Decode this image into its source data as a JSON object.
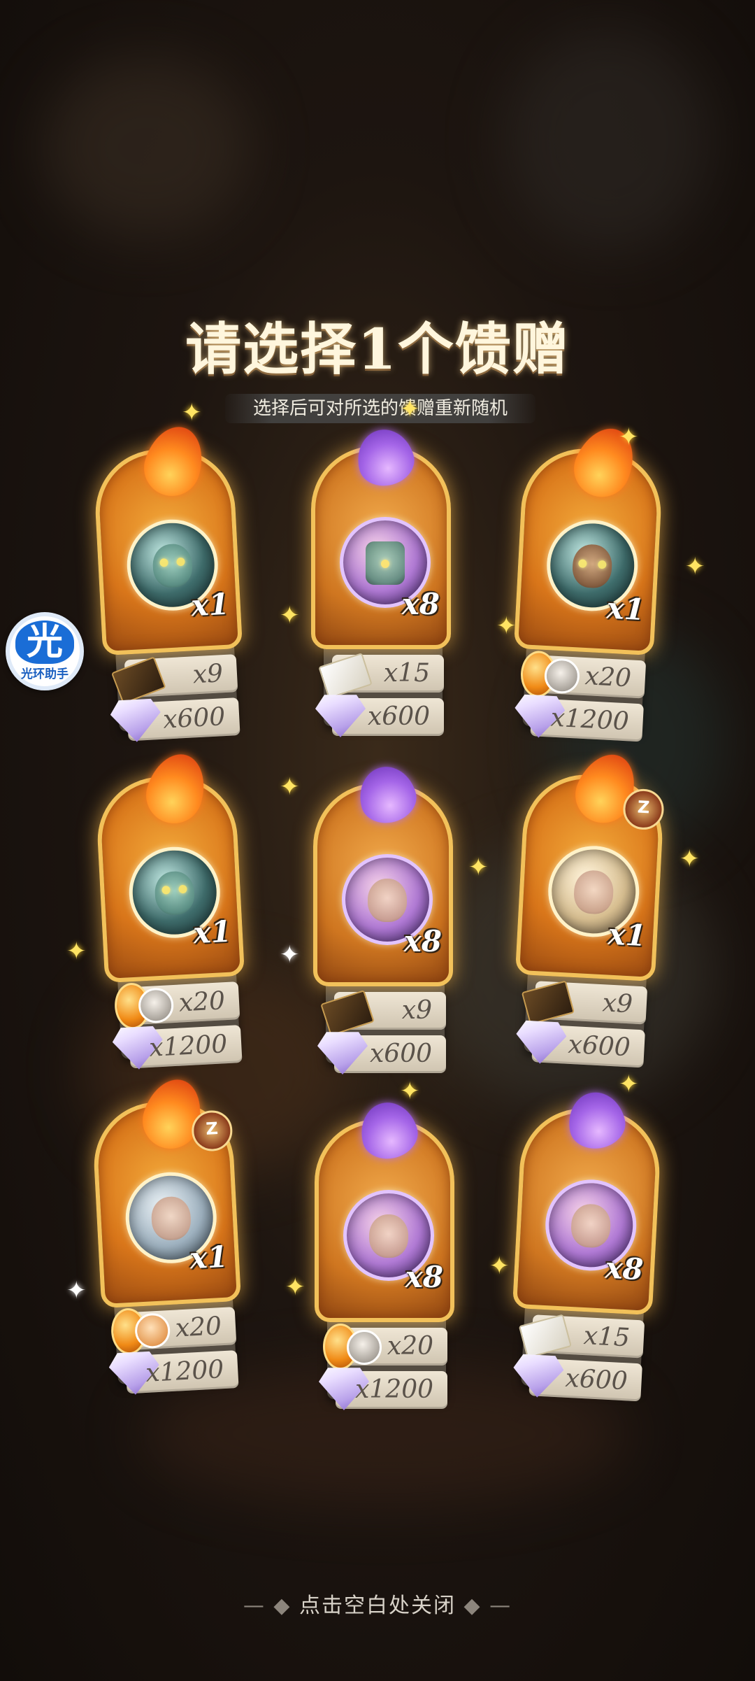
{
  "title": "请选择1个馈赠",
  "subtitle": "选择后可对所选的馈赠重新随机",
  "close_hint": "点击空白处关闭",
  "floating_button": {
    "icon_char": "光",
    "label": "光环助手"
  },
  "cards": [
    {
      "style": "fire",
      "multiplier": "x1",
      "item1_icon": "ticket-icon",
      "item1_value": "x9",
      "item2_value": "x600",
      "badge": ""
    },
    {
      "style": "violet",
      "multiplier": "x8",
      "item1_icon": "letter-icon",
      "item1_value": "x15",
      "item2_value": "x600",
      "badge": ""
    },
    {
      "style": "fire",
      "multiplier": "x1",
      "item1_icon": "coin-avatar-icon",
      "item1_value": "x20",
      "item2_value": "x1200",
      "badge": ""
    },
    {
      "style": "fire",
      "multiplier": "x1",
      "item1_icon": "coin-avatar-icon",
      "item1_value": "x20",
      "item2_value": "x1200",
      "badge": ""
    },
    {
      "style": "violet",
      "multiplier": "x8",
      "item1_icon": "ticket-icon",
      "item1_value": "x9",
      "item2_value": "x600",
      "badge": ""
    },
    {
      "style": "fire",
      "multiplier": "x1",
      "item1_icon": "ticket-icon",
      "item1_value": "x9",
      "item2_value": "x600",
      "badge": "Z"
    },
    {
      "style": "fire",
      "multiplier": "x1",
      "item1_icon": "coin-avatar-icon",
      "item1_value": "x20",
      "item2_value": "x1200",
      "badge": "Z"
    },
    {
      "style": "violet",
      "multiplier": "x8",
      "item1_icon": "coin-avatar-icon",
      "item1_value": "x20",
      "item2_value": "x1200",
      "badge": ""
    },
    {
      "style": "violet",
      "multiplier": "x8",
      "item1_icon": "letter-icon",
      "item1_value": "x15",
      "item2_value": "x600",
      "badge": ""
    }
  ]
}
